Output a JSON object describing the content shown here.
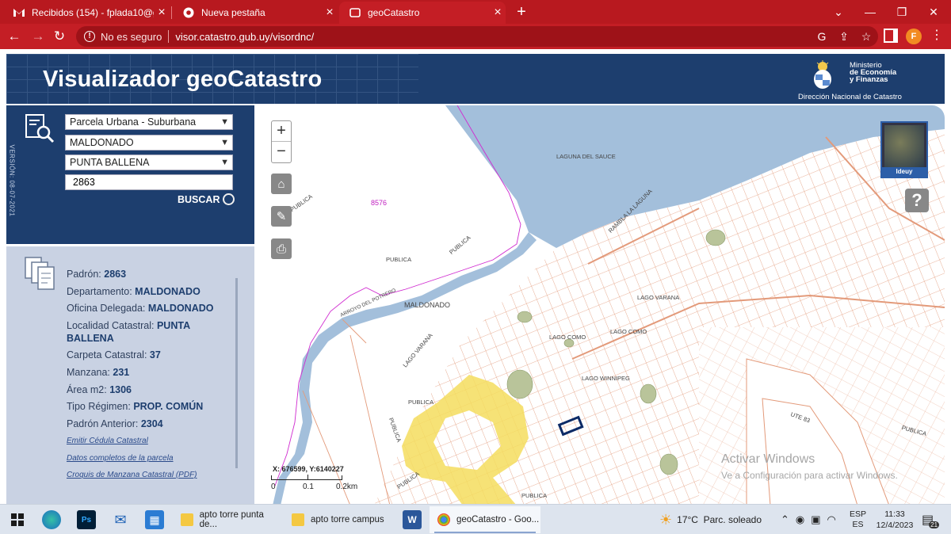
{
  "browser": {
    "tabs": [
      {
        "title": "Recibidos (154) - fplada10@gma",
        "icon": "gmail-icon",
        "active": false
      },
      {
        "title": "Nueva pestaña",
        "icon": "chrome-icon",
        "active": false
      },
      {
        "title": "geoCatastro",
        "icon": "geocatastro-favicon",
        "active": true
      }
    ],
    "new_tab": "+",
    "not_secure": "No es seguro",
    "url": "visor.catastro.gub.uy/visordnc/",
    "profile_initial": "F"
  },
  "header": {
    "title": "Visualizador geoCatastro",
    "ministry_line1": "Ministerio",
    "ministry_line2": "de Economía",
    "ministry_line3": "y Finanzas",
    "subtitle": "Dirección Nacional de Catastro"
  },
  "search": {
    "version": "VERSIÓN: 08-07-2021",
    "type_select": "Parcela Urbana - Suburbana",
    "department_select": "MALDONADO",
    "locality_select": "PUNTA BALLENA",
    "padron_value": "2863",
    "search_button": "BUSCAR"
  },
  "info": {
    "padron_label": "Padrón:",
    "padron": "2863",
    "depto_label": "Departamento:",
    "depto": "MALDONADO",
    "oficina_label": "Oficina Delegada:",
    "oficina": "MALDONADO",
    "localidad_label": "Localidad Catastral:",
    "localidad": "PUNTA BALLENA",
    "carpeta_label": "Carpeta Catastral:",
    "carpeta": "37",
    "manzana_label": "Manzana:",
    "manzana": "231",
    "area_label": "Área m2:",
    "area": "1306",
    "regimen_label": "Tipo Régimen:",
    "regimen": "PROP. COMÚN",
    "anterior_label": "Padrón Anterior:",
    "anterior": "2304",
    "link_cedula": "Emitir Cédula Catastral",
    "link_datos": "Datos completos de la parcela",
    "link_croquis": "Croquis de Manzana Catastral (PDF)"
  },
  "map": {
    "zoom_in": "+",
    "zoom_out": "−",
    "ideuy": "Ideuy",
    "help": "?",
    "coords": "X: 676599, Y:6140227",
    "scale_0": "0",
    "scale_1": "0.1",
    "scale_2": "0.2km",
    "watermark1": "Activar Windows",
    "watermark2": "Ve a Configuración para activar Windows.",
    "labels": {
      "laguna_sauce": "LAGUNA DEL SAUCE",
      "n8576": "8576",
      "publica": "PUBLICA",
      "maldonado": "MALDONADO",
      "lago_varana": "LAGO VARANA",
      "lago_como": "LAGO COMO",
      "lago_winnipeg": "LAGO WINNIPEG",
      "ute": "UTE 83",
      "rambla": "RAMBLA LA LAGUNA",
      "arroyo": "ARROYO DEL POTRERO"
    }
  },
  "taskbar": {
    "apps": [
      {
        "label": "apto torre punta de...",
        "icon": "folder-icon"
      },
      {
        "label": "apto torre campus",
        "icon": "folder-icon"
      },
      {
        "label": "geoCatastro - Goo...",
        "icon": "chrome-icon"
      }
    ],
    "weather": "17°C  Parc. soleado",
    "lang1": "ESP",
    "lang2": "ES",
    "time": "11:33",
    "date": "12/4/2023",
    "notif_count": "21"
  },
  "colors": {
    "chrome_red": "#c41e25",
    "header_blue": "#1d3e6e",
    "water": "#a3bfdb",
    "parcel_lines": "#e39a7a",
    "selected_parcel": "#0c2a66"
  }
}
